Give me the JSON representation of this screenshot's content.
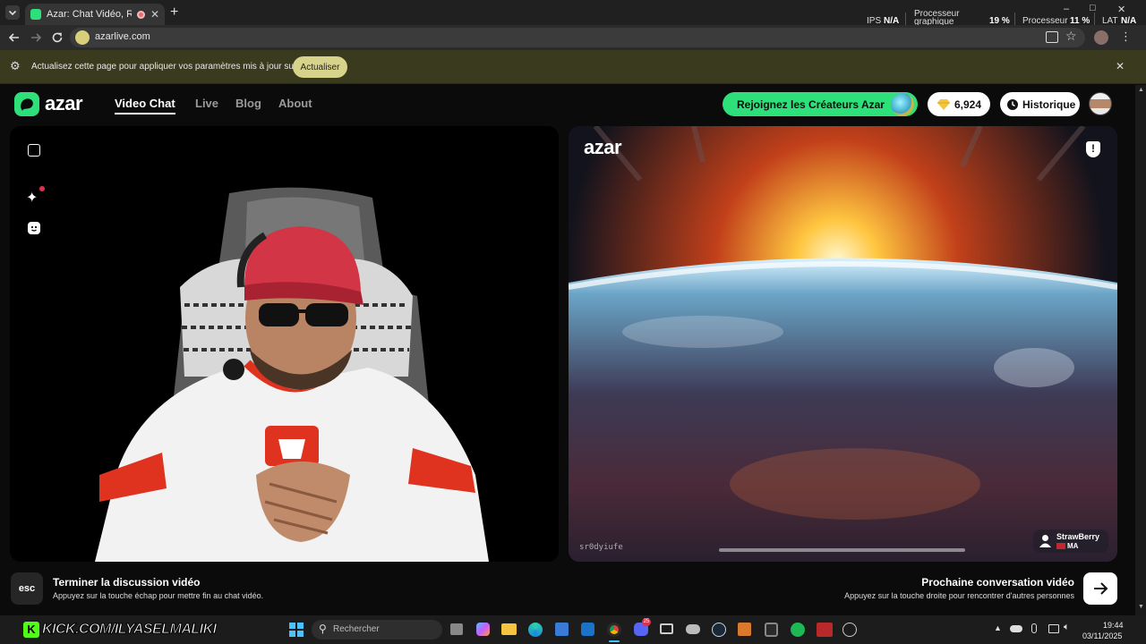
{
  "browser": {
    "tab_title": "Azar: Chat Vidéo, Rencontr",
    "new_tab_glyph": "+",
    "url": "azarlive.com",
    "window_controls": [
      "–",
      "□",
      "✕"
    ]
  },
  "perf_overlay": {
    "ips_label": "IPS",
    "ips_value": "N/A",
    "gpu_label_1": "Processeur",
    "gpu_label_2": "graphique",
    "gpu_value": "19 %",
    "cpu_label": "Processeur",
    "cpu_value": "11 %",
    "lat_label": "LAT",
    "lat_value": "N/A"
  },
  "infobar": {
    "message": "Actualisez cette page pour appliquer vos paramètres mis à jour sur ce site",
    "button": "Actualiser"
  },
  "site": {
    "logo_text": "azar",
    "nav": [
      "Video Chat",
      "Live",
      "Blog",
      "About"
    ],
    "creators_button": "Rejoignez les Créateurs Azar",
    "gems": "6,924",
    "history_button": "Historique"
  },
  "remote_video": {
    "watermark": "azar",
    "code": "sr0dyiufe",
    "username": "StrawBerry",
    "country": "MA"
  },
  "footer": {
    "esc_key": "esc",
    "end_title": "Terminer la discussion vidéo",
    "end_sub": "Appuyez sur la touche échap pour mettre fin au chat vidéo.",
    "next_title": "Prochaine conversation vidéo",
    "next_sub": "Appuyez sur la touche droite pour rencontrer d'autres personnes"
  },
  "taskbar": {
    "stream_url": "KICK.COM/ILYASELMALIKI",
    "search_placeholder": "Rechercher",
    "time": "19:44",
    "date": "03/11/2025",
    "discord_badge": "25"
  },
  "colors": {
    "brand_green": "#2ee07a",
    "accent_red": "#e0314a",
    "gold": "#f3c63b"
  }
}
